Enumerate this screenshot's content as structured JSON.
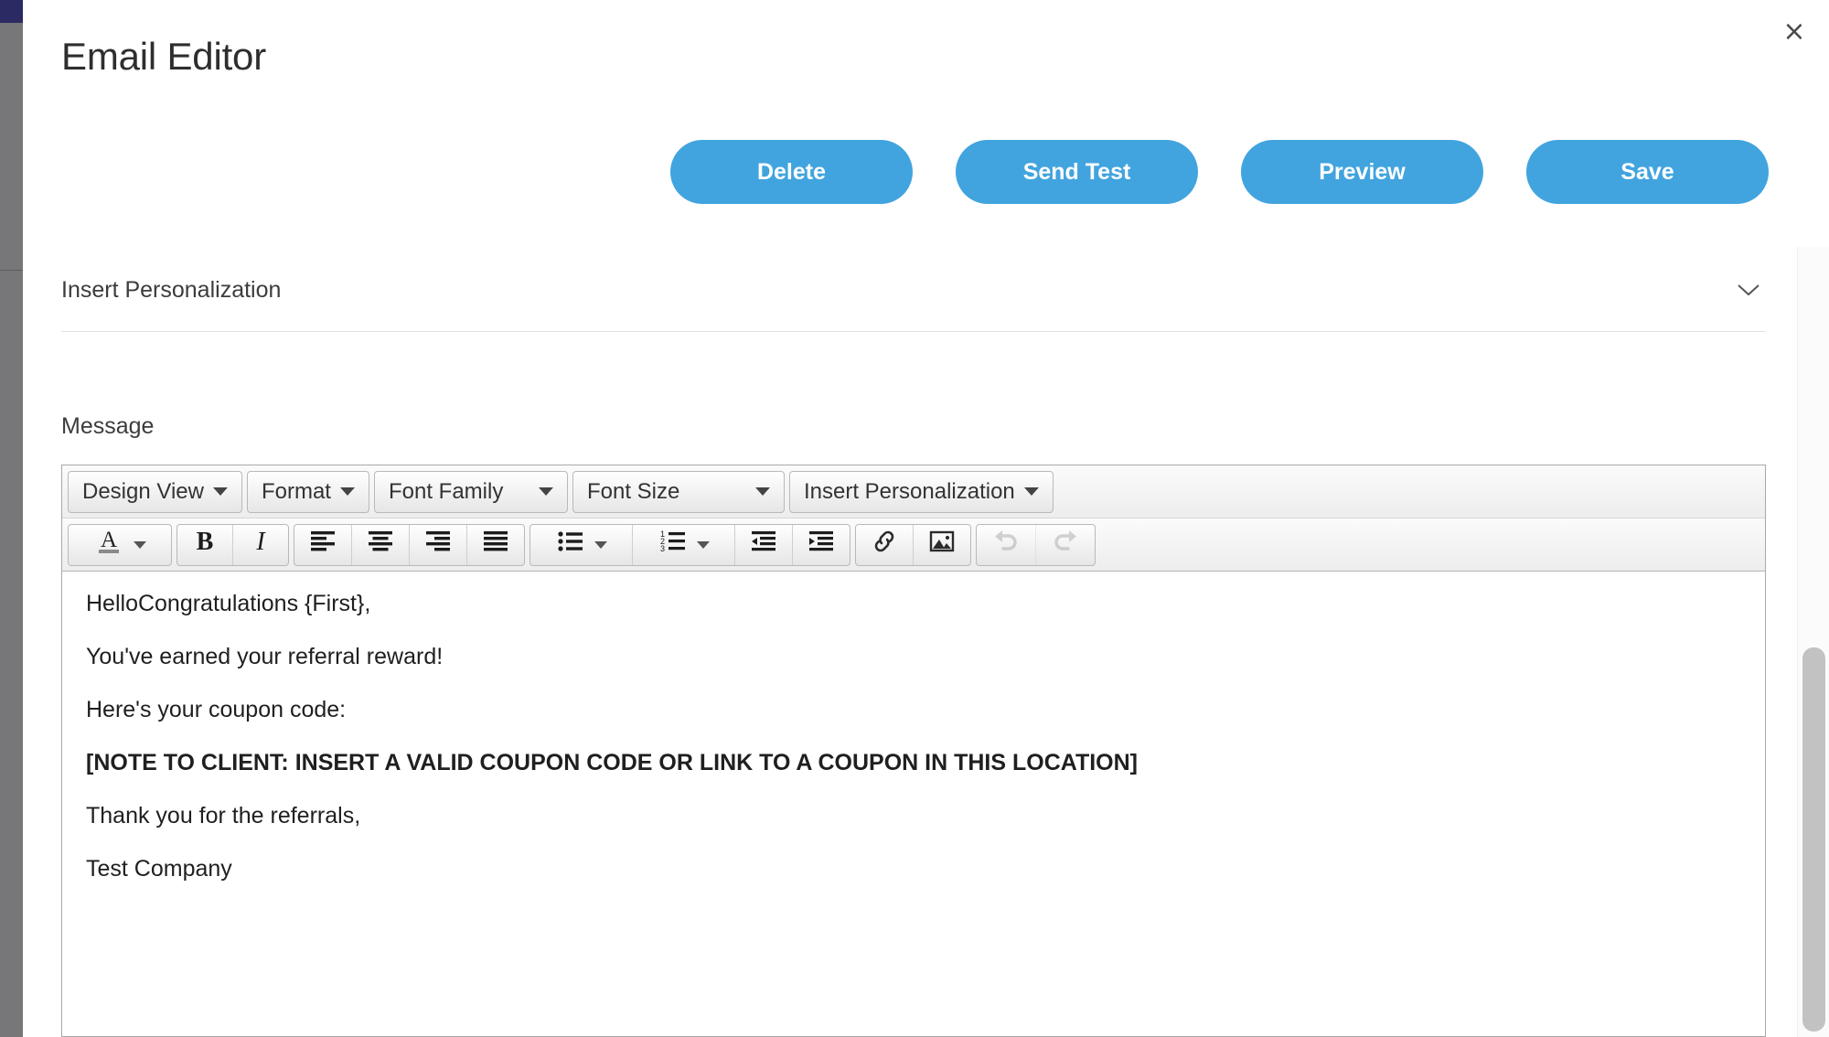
{
  "window": {
    "title": "Email Editor",
    "close_label": "×"
  },
  "actions": {
    "delete_label": "Delete",
    "send_test_label": "Send Test",
    "preview_label": "Preview",
    "save_label": "Save",
    "button_color": "#41a4df",
    "button_text_color": "#ffffff"
  },
  "personalization_accordion": {
    "label": "Insert Personalization",
    "chevron_icon": "chevron-down-icon",
    "expanded": false
  },
  "message": {
    "label": "Message",
    "toolbar_row1": [
      {
        "label": "Design View",
        "icon": "chevron-down-icon",
        "has_caret": true,
        "name": "design-view"
      },
      {
        "label": "Format",
        "icon": "chevron-down-icon",
        "has_caret": true,
        "name": "format"
      },
      {
        "label": "Font Family",
        "icon": "chevron-down-icon",
        "has_caret": true,
        "name": "font-family"
      },
      {
        "label": "Font Size",
        "icon": "chevron-down-icon",
        "has_caret": true,
        "name": "font-size"
      },
      {
        "label": "Insert Personalization",
        "icon": "chevron-down-icon",
        "has_caret": true,
        "name": "insert-personalization"
      }
    ],
    "toolbar_row2": [
      {
        "icon": "text-color-icon",
        "has_caret": true,
        "name": "text-color",
        "disabled": false
      },
      {
        "icon": "bold-icon",
        "has_caret": false,
        "name": "bold",
        "disabled": false
      },
      {
        "icon": "italic-icon",
        "has_caret": false,
        "name": "italic",
        "disabled": false
      },
      {
        "icon": "align-left-icon",
        "has_caret": false,
        "name": "align-left",
        "disabled": false
      },
      {
        "icon": "align-center-icon",
        "has_caret": false,
        "name": "align-center",
        "disabled": false
      },
      {
        "icon": "align-right-icon",
        "has_caret": false,
        "name": "align-right",
        "disabled": false
      },
      {
        "icon": "align-justify-icon",
        "has_caret": false,
        "name": "align-justify",
        "disabled": false
      },
      {
        "icon": "bullet-list-icon",
        "has_caret": true,
        "name": "bullet-list",
        "disabled": false
      },
      {
        "icon": "numbered-list-icon",
        "has_caret": true,
        "name": "numbered-list",
        "disabled": false
      },
      {
        "icon": "outdent-icon",
        "has_caret": false,
        "name": "outdent",
        "disabled": false
      },
      {
        "icon": "indent-icon",
        "has_caret": false,
        "name": "indent",
        "disabled": false
      },
      {
        "icon": "link-icon",
        "has_caret": false,
        "name": "insert-link",
        "disabled": false
      },
      {
        "icon": "image-icon",
        "has_caret": false,
        "name": "insert-image",
        "disabled": false
      },
      {
        "icon": "undo-icon",
        "has_caret": false,
        "name": "undo",
        "disabled": true
      },
      {
        "icon": "redo-icon",
        "has_caret": false,
        "name": "redo",
        "disabled": true
      }
    ],
    "body_lines": [
      {
        "text": "HelloCongratulations {First},",
        "bold": false
      },
      {
        "text": "You've earned your referral reward!",
        "bold": false
      },
      {
        "text": "Here's your coupon code:",
        "bold": false
      },
      {
        "text": "[NOTE TO CLIENT: INSERT A VALID COUPON CODE OR LINK TO A COUPON IN THIS LOCATION]",
        "bold": true
      },
      {
        "text": "Thank you for the referrals,",
        "bold": false
      },
      {
        "text": "Test Company",
        "bold": false
      }
    ]
  },
  "scrollbar": {
    "orientation": "vertical",
    "thumb_color": "#c2c2c2"
  }
}
